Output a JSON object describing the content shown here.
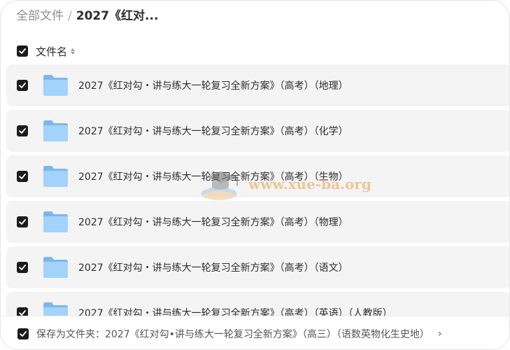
{
  "breadcrumb": {
    "root": "全部文件",
    "separator": "/",
    "current": "2027《红对..."
  },
  "header": {
    "label": "文件名"
  },
  "rows": [
    {
      "name": "2027《红对勾・讲与练大一轮复习全新方案》（高考）（地理）"
    },
    {
      "name": "2027《红对勾・讲与练大一轮复习全新方案》（高考）（化学）"
    },
    {
      "name": "2027《红对勾・讲与练大一轮复习全新方案》（高考）（生物）"
    },
    {
      "name": "2027《红对勾・讲与练大一轮复习全新方案》（高考）（物理）"
    },
    {
      "name": "2027《红对勾・讲与练大一轮复习全新方案》（高考）（语文）"
    },
    {
      "name": "2027《红对勾・讲与练大一轮复习全新方案》（高考）（英语）（人教版）"
    }
  ],
  "watermark": {
    "text": "www.xue-ba.org"
  },
  "footer": {
    "save_to": "保存为文件夹：2027《红对勾•讲与练大一轮复习全新方案》（高三）（语数英物化生史地）",
    "chevron": "›"
  },
  "colors": {
    "checkbox": "#1c1c1e",
    "folder": "#8cc4f4",
    "row_bg": "#f4f4f5"
  },
  "icons": {
    "row": "folder-icon",
    "check": "check-icon",
    "sort": "sort-icon"
  }
}
